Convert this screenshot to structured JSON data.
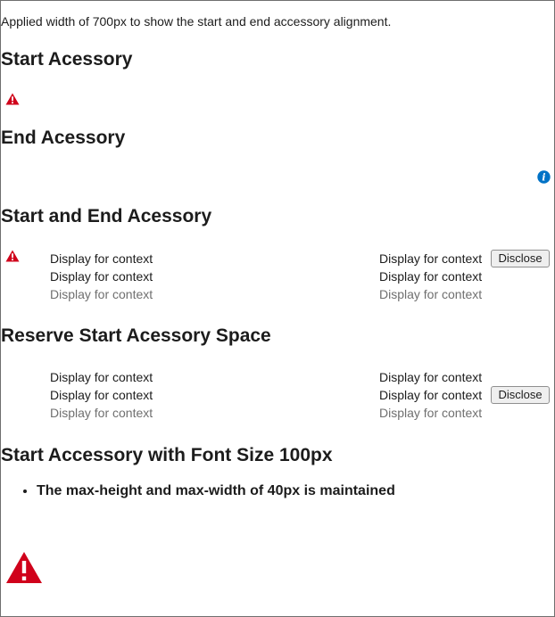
{
  "intro_text": "Applied width of 700px to show the start and end accessory alignment.",
  "sections": {
    "start": {
      "title": "Start Acessory"
    },
    "end": {
      "title": "End Acessory"
    },
    "start_end": {
      "title": "Start and End Acessory",
      "rows": [
        [
          "Display for context",
          "Display for context"
        ],
        [
          "Display for context",
          "Display for context"
        ],
        [
          "Display for context",
          "Display for context"
        ]
      ],
      "button_label": "Disclose"
    },
    "reserve": {
      "title": "Reserve Start Acessory Space",
      "rows": [
        [
          "Display for context",
          "Display for context"
        ],
        [
          "Display for context",
          "Display for context"
        ],
        [
          "Display for context",
          "Display for context"
        ]
      ],
      "button_label": "Disclose"
    },
    "big_font": {
      "title": "Start Accessory with Font Size 100px",
      "note": "The max-height and max-width of 40px is maintained"
    }
  },
  "icons": {
    "warning": "warning-triangle-icon",
    "info": "info-circle-icon"
  },
  "colors": {
    "warning": "#d0021b",
    "info": "#0072c6",
    "text_primary": "#1c1c1c",
    "text_secondary": "#6f6f6f"
  }
}
